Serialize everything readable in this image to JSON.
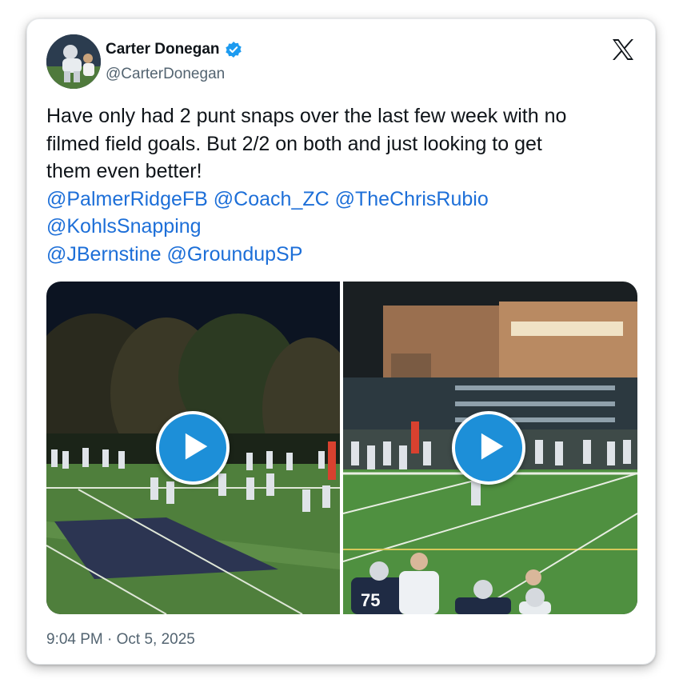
{
  "author": {
    "display_name": "Carter Donegan",
    "handle": "@CarterDonegan",
    "verified": true,
    "verified_icon": "verified-badge-icon",
    "verified_color": "#1d9bf0"
  },
  "platform_icon": "x-logo-icon",
  "tweet": {
    "line1": "Have only had 2 punt snaps over the last few week with no",
    "line2": "filmed field goals. But 2/2 on both and just looking to get",
    "line3": "them even better!",
    "mentions": {
      "palmer": "@PalmerRidgeFB",
      "coach": "@Coach_ZC",
      "rubio": "@TheChrisRubio",
      "kohls": "@KohlsSnapping",
      "bernstine": "@JBernstine",
      "groundup": "@GroundupSP"
    }
  },
  "media": {
    "videos": [
      {
        "icon": "play-icon"
      },
      {
        "icon": "play-icon"
      }
    ],
    "scoreboard_number": "75"
  },
  "timestamp": "9:04 PM · Oct 5, 2025",
  "colors": {
    "mention": "#1d6fd8",
    "play_button": "#1d8fd8",
    "text": "#0f1419",
    "muted": "#536471"
  }
}
